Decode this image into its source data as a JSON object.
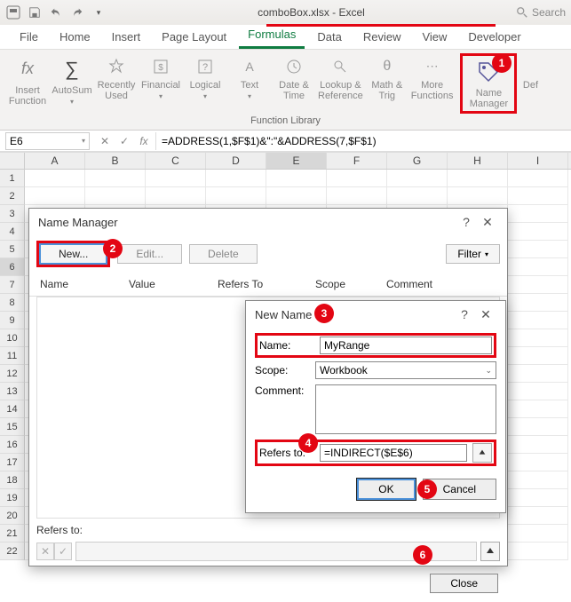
{
  "titlebar": {
    "filename": "comboBox.xlsx - Excel",
    "search_placeholder": "Search"
  },
  "tabs": {
    "file": "File",
    "home": "Home",
    "insert": "Insert",
    "page_layout": "Page Layout",
    "formulas": "Formulas",
    "data": "Data",
    "review": "Review",
    "view": "View",
    "developer": "Developer"
  },
  "ribbon": {
    "insert_function": "Insert\nFunction",
    "autosum": "AutoSum",
    "recently_used": "Recently\nUsed",
    "financial": "Financial",
    "logical": "Logical",
    "text": "Text",
    "date_time": "Date &\nTime",
    "lookup_ref": "Lookup &\nReference",
    "math_trig": "Math &\nTrig",
    "more_functions": "More\nFunctions",
    "name_manager": "Name\nManager",
    "def": "Def",
    "group_label": "Function Library"
  },
  "formula_bar": {
    "cell_ref": "E6",
    "formula": "=ADDRESS(1,$F$1)&\":\"&ADDRESS(7,$F$1)"
  },
  "columns": [
    "A",
    "B",
    "C",
    "D",
    "E",
    "F",
    "G",
    "H",
    "I"
  ],
  "rows": [
    "1",
    "2",
    "3",
    "4",
    "5",
    "6",
    "7",
    "8",
    "9",
    "10",
    "11",
    "12",
    "13",
    "14",
    "15",
    "16",
    "17",
    "18",
    "19",
    "20",
    "21",
    "22"
  ],
  "name_manager": {
    "title": "Name Manager",
    "new_btn": "New...",
    "edit_btn": "Edit...",
    "delete_btn": "Delete",
    "filter_btn": "Filter",
    "col_name": "Name",
    "col_value": "Value",
    "col_refers": "Refers To",
    "col_scope": "Scope",
    "col_comment": "Comment",
    "refers_to_label": "Refers to:",
    "close_btn": "Close"
  },
  "new_name": {
    "title": "New Name",
    "name_label": "Name:",
    "name_value": "MyRange",
    "scope_label": "Scope:",
    "scope_value": "Workbook",
    "comment_label": "Comment:",
    "refers_label": "Refers to:",
    "refers_value": "=INDIRECT($E$6)",
    "ok_btn": "OK",
    "cancel_btn": "Cancel"
  },
  "callouts": {
    "c1": "1",
    "c2": "2",
    "c3": "3",
    "c4": "4",
    "c5": "5",
    "c6": "6"
  }
}
